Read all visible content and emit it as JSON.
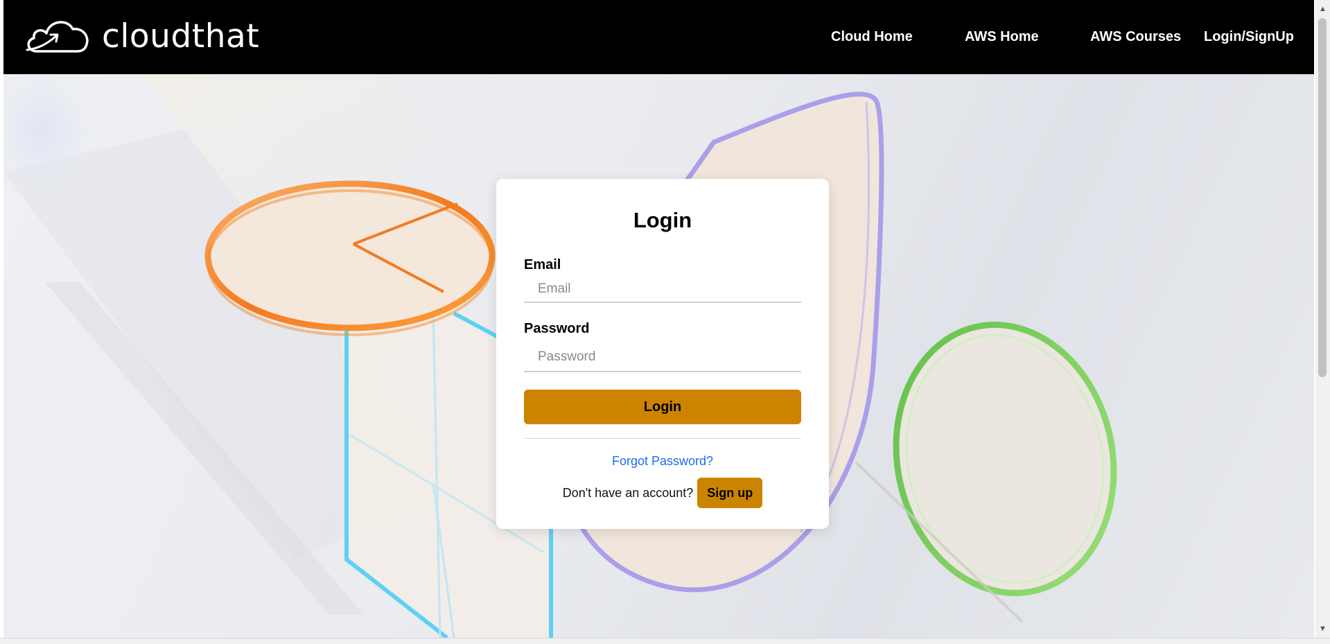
{
  "brand": {
    "name": "cloudthat",
    "logo_icon": "cloud-arrow-icon"
  },
  "nav": {
    "items": [
      {
        "label": "Cloud Home"
      },
      {
        "label": "AWS Home"
      },
      {
        "label": "AWS Courses"
      },
      {
        "label": "Login/SignUp"
      }
    ]
  },
  "login": {
    "title": "Login",
    "email_label": "Email",
    "email_placeholder": "Email",
    "email_value": "",
    "password_label": "Password",
    "password_placeholder": "Password",
    "password_value": "",
    "login_button": "Login",
    "forgot_link": "Forgot Password?",
    "no_account_text": "Don't have an account?",
    "signup_button": "Sign up"
  },
  "colors": {
    "nav_bg": "#000000",
    "accent": "#cc8400",
    "link": "#1a6cf0",
    "shape_orange": "#f7892a",
    "shape_cyan": "#5fd0f5",
    "shape_purple": "#a79ae8",
    "shape_green": "#7fcf5a"
  }
}
